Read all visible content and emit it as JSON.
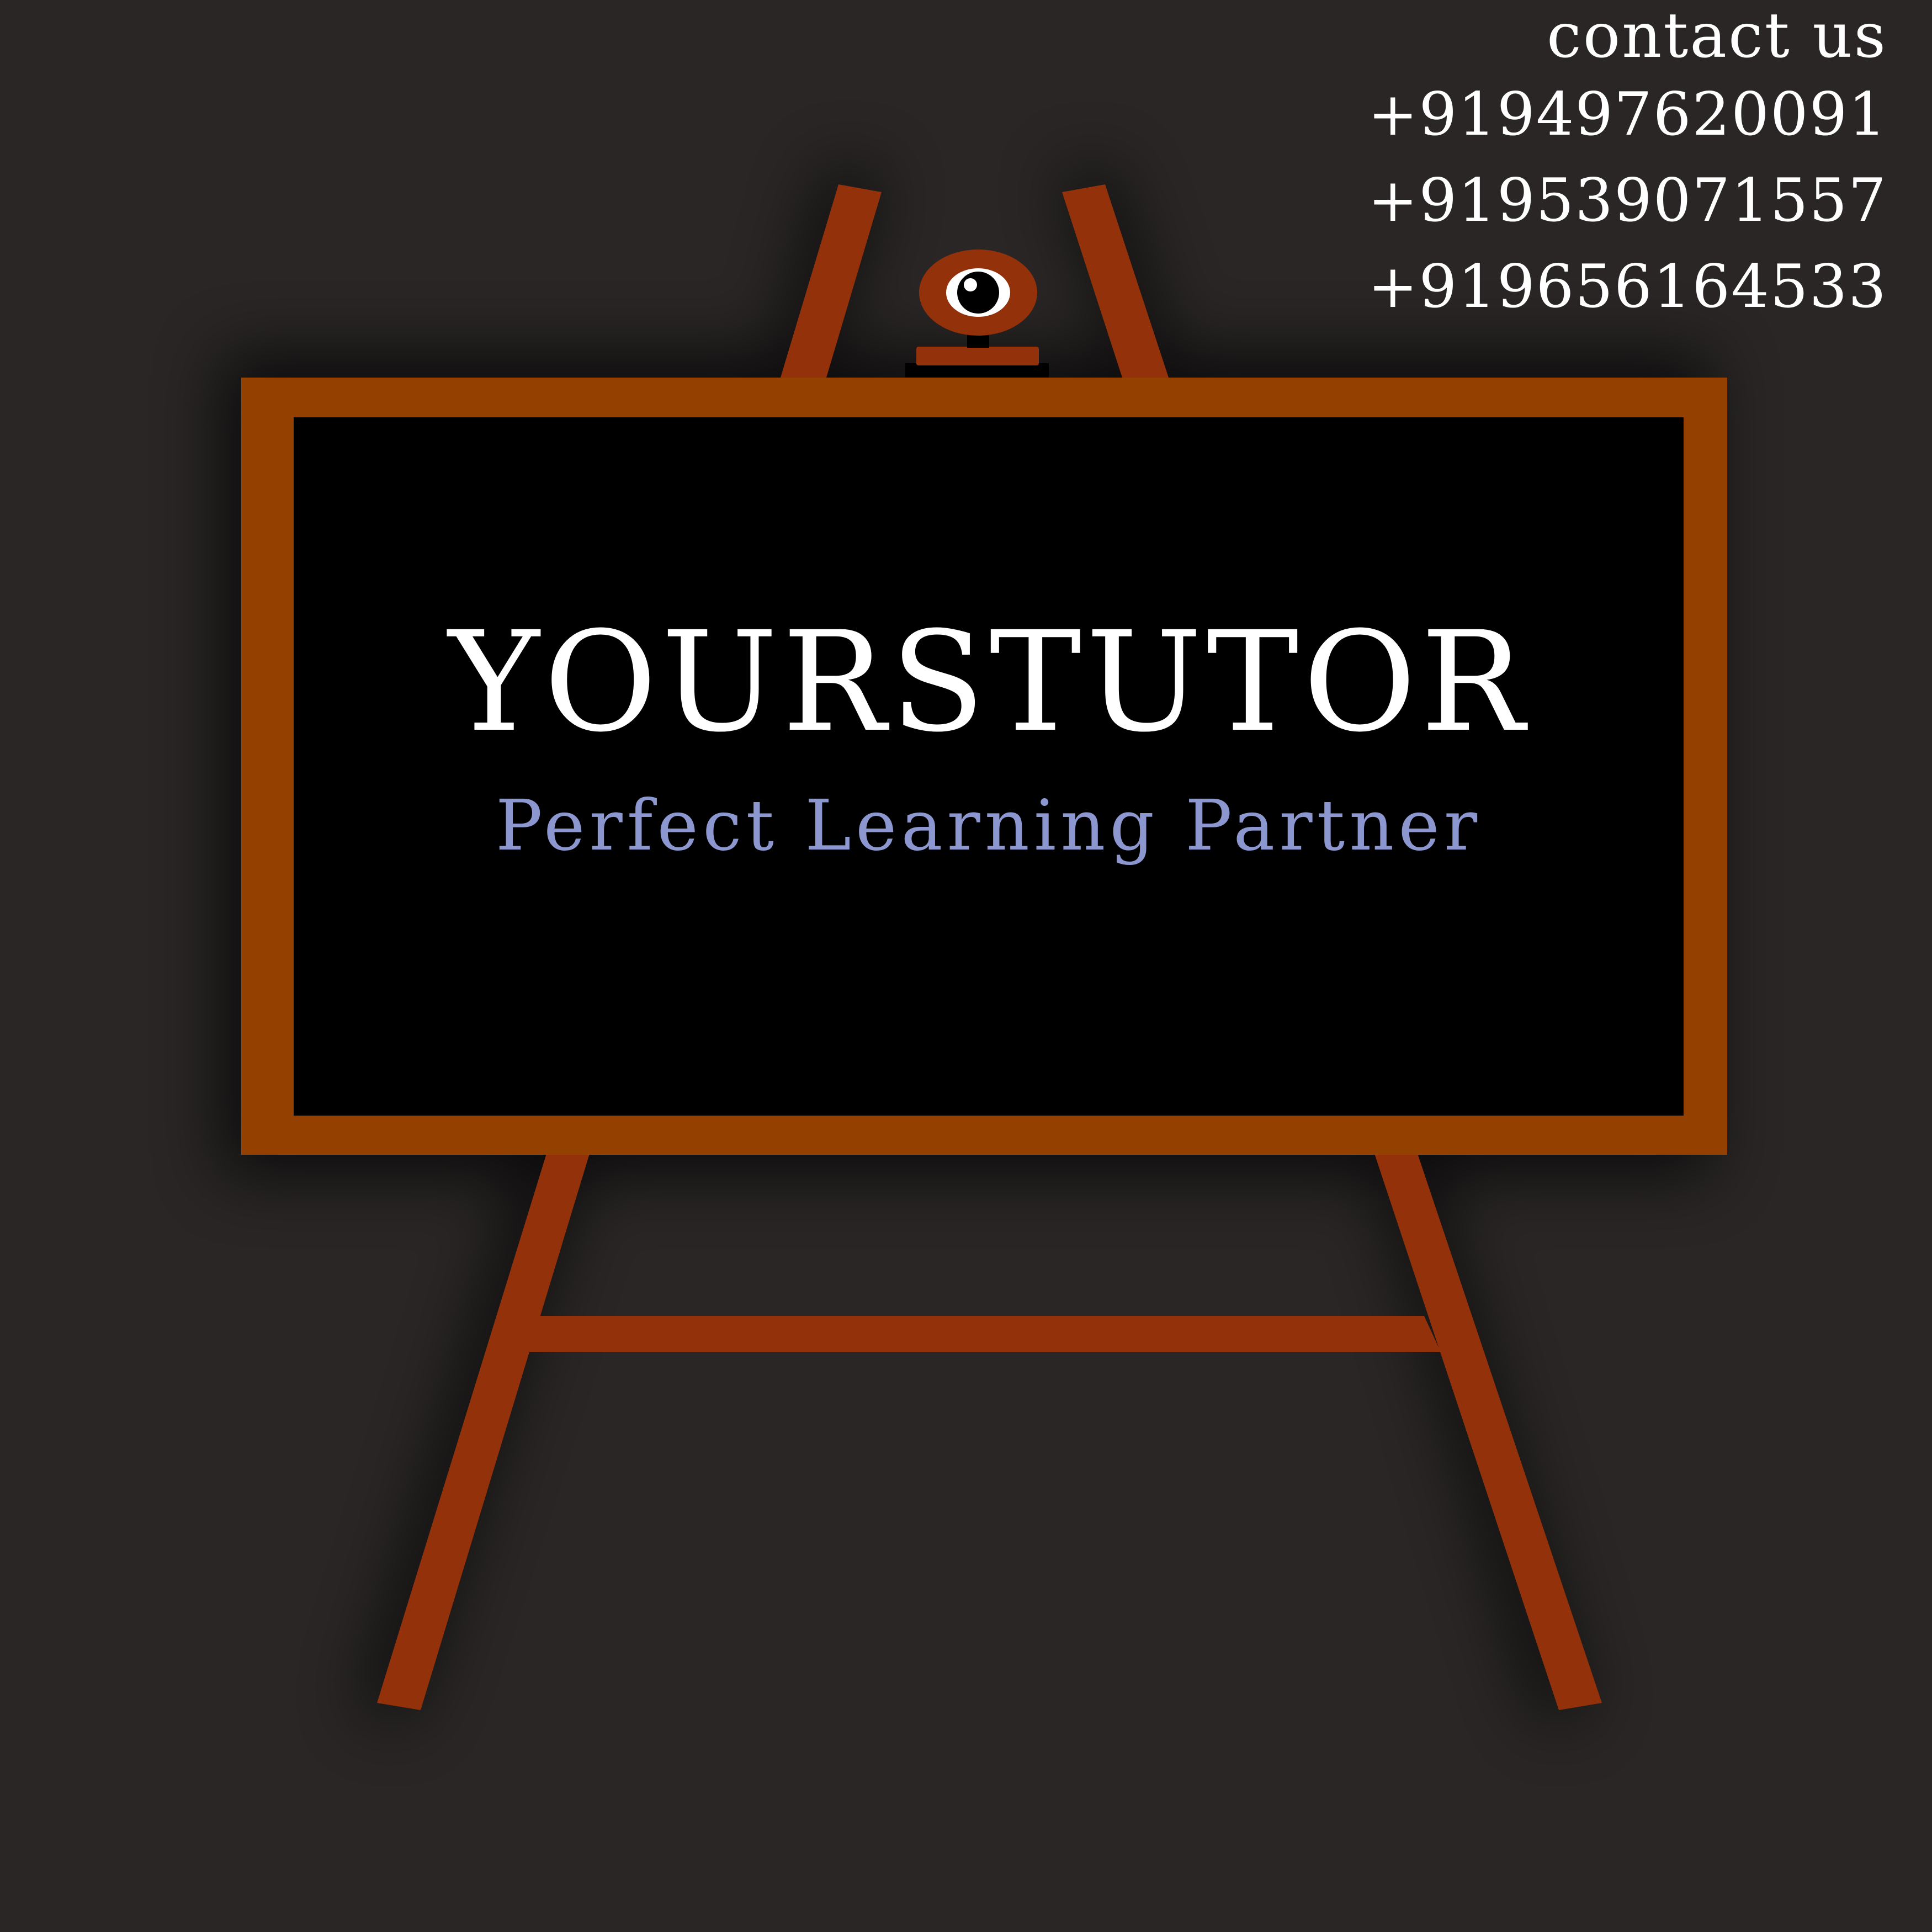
{
  "contact": {
    "heading": "contact us",
    "phones": [
      "+919497620091",
      "+919539071557",
      "+919656164533"
    ]
  },
  "board": {
    "title": "YOURSTUTOR",
    "tagline": "Perfect Learning Partner"
  },
  "colors": {
    "background": "#2a2626",
    "easel_wood": "#93310a",
    "frame_wood": "#934000",
    "board_surface": "#000000",
    "title_text": "#ffffff",
    "tagline_text": "#8c97d0"
  },
  "icons": {
    "board_clamp": "webcam-icon"
  }
}
